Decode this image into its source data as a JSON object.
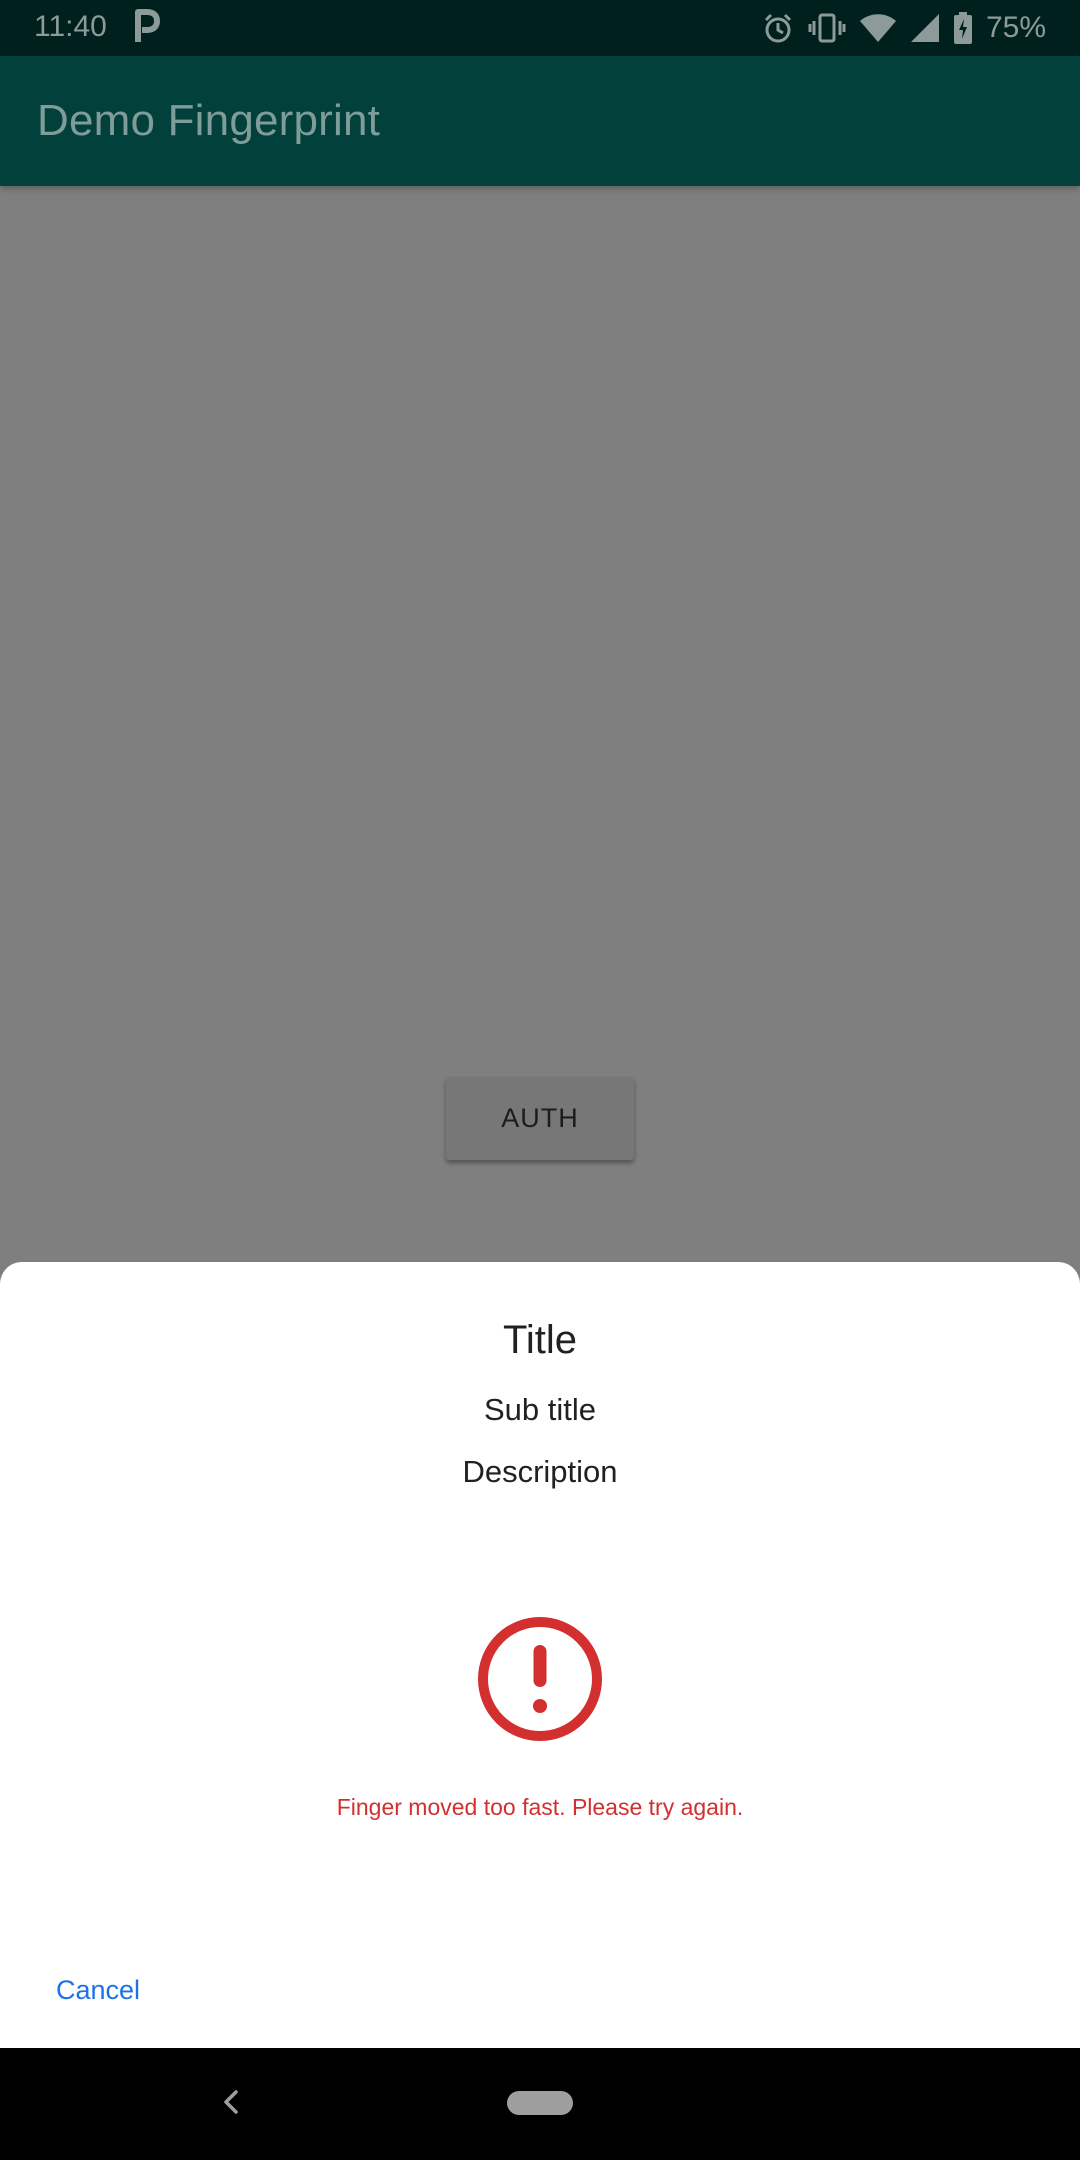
{
  "status_bar": {
    "time": "11:40",
    "left_icons": [
      "parking-p-icon"
    ],
    "right_icons": [
      "alarm-icon",
      "vibrate-icon",
      "wifi-icon",
      "cell-signal-icon",
      "battery-charging-icon"
    ],
    "battery_percent": "75%"
  },
  "app_bar": {
    "title": "Demo Fingerprint",
    "color": "#02403b"
  },
  "main": {
    "auth_button_label": "AUTH"
  },
  "dialog": {
    "title": "Title",
    "subtitle": "Sub title",
    "description": "Description",
    "error_icon": "error-circle-icon",
    "error_message": "Finger moved too fast. Please try again.",
    "error_color": "#d32f2f",
    "cancel_label": "Cancel",
    "accent_color": "#1a73e8"
  },
  "nav_bar": {
    "icons": [
      "back-icon",
      "home-pill-icon"
    ]
  }
}
